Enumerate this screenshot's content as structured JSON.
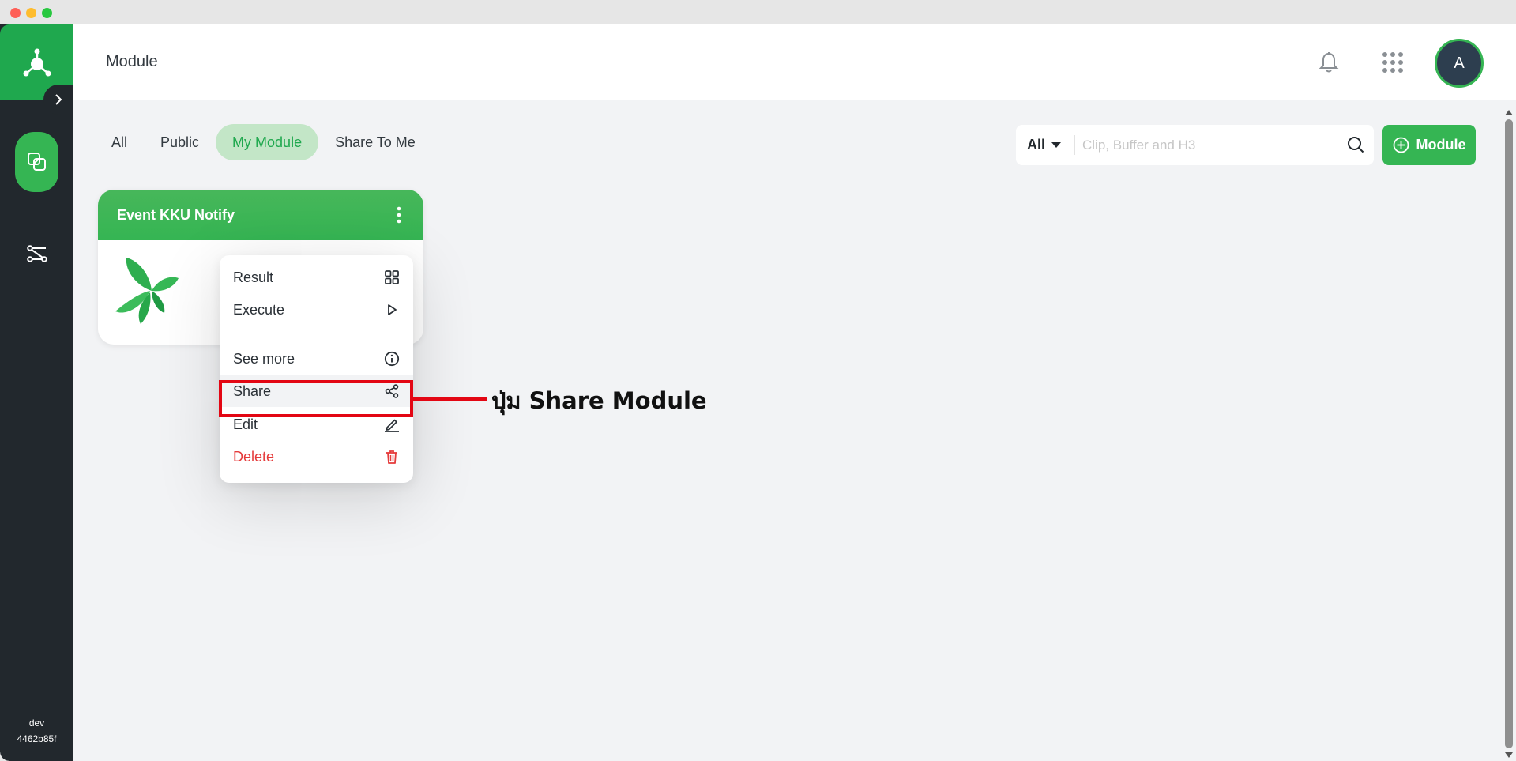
{
  "window": {
    "title": "Module"
  },
  "sidebar": {
    "env": "dev",
    "build": "4462b85f"
  },
  "topbar": {
    "avatar_initial": "A"
  },
  "tabs": [
    {
      "label": "All",
      "active": false
    },
    {
      "label": "Public",
      "active": false
    },
    {
      "label": "My Module",
      "active": true
    },
    {
      "label": "Share To Me",
      "active": false
    }
  ],
  "search": {
    "filter_value": "All",
    "placeholder": "Clip, Buffer and H3"
  },
  "add_button": {
    "label": "Module"
  },
  "card": {
    "title": "Event KKU Notify"
  },
  "menu": {
    "result": "Result",
    "execute": "Execute",
    "see_more": "See more",
    "share": "Share",
    "edit": "Edit",
    "delete": "Delete"
  },
  "annotation": {
    "callout": "ปุ่ม Share Module"
  },
  "colors": {
    "brand_green": "#35b553",
    "sidebar_dark": "#22282d",
    "danger": "#e53b3b",
    "highlight": "#e30613"
  }
}
